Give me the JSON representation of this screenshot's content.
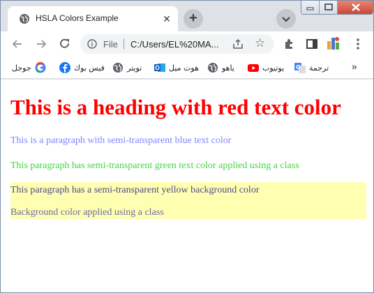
{
  "browser": {
    "tab": {
      "title": "HSLA Colors Example",
      "close_glyph": "✕",
      "favicon": "globe-icon"
    },
    "new_tab_glyph": "+",
    "toolbar": {
      "scheme_label": "File",
      "url": "C:/Users/EL%20MA...",
      "icons": [
        "back-arrow-icon",
        "forward-arrow-icon",
        "reload-icon",
        "info-icon",
        "share-icon",
        "star-icon",
        "extensions-icon",
        "side-panel-icon",
        "profile-icon",
        "menu-icon"
      ]
    },
    "bookmarks": [
      {
        "label": "ترجمة",
        "icon": "google-translate-icon",
        "color": "#4285f4"
      },
      {
        "label": "يوتيوب",
        "icon": "youtube-icon",
        "color": "#ff0000"
      },
      {
        "label": "ياهو",
        "icon": "globe-icon",
        "color": "#5f6368"
      },
      {
        "label": "هوت ميل",
        "icon": "outlook-icon",
        "color": "#0f5eb8"
      },
      {
        "label": "تويتر",
        "icon": "globe-icon",
        "color": "#5f6368"
      },
      {
        "label": "فيس بوك",
        "icon": "facebook-icon",
        "color": "#1877f2"
      },
      {
        "label": "جوجل",
        "icon": "google-icon",
        "color": "#4285f4"
      }
    ],
    "bookmarks_more_glyph": "»"
  },
  "page": {
    "heading": "This is a heading with red text color",
    "p1": "This is a paragraph with semi-transparent blue text color",
    "p2": "This paragraph has semi-transparent green text color applied using a class",
    "p3": "This paragraph has a semi-transparent yellow background color",
    "p4": "Background color applied using a class"
  },
  "colors": {
    "heading": "#ff0000",
    "blue_text": "rgba(0,0,255,0.5)",
    "green_text": "rgba(0,200,0,0.75)",
    "yellow_bg": "rgba(255,255,0,0.3)"
  }
}
